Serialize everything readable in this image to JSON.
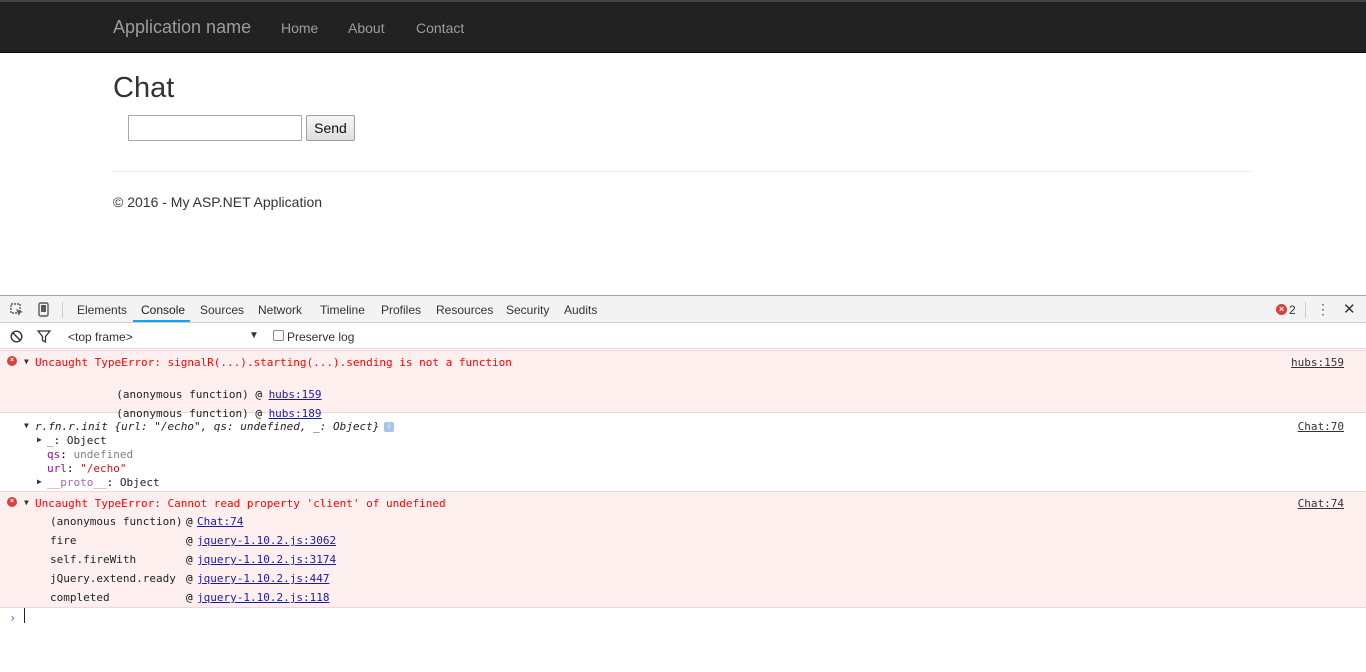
{
  "navbar": {
    "brand": "Application name",
    "links": [
      "Home",
      "About",
      "Contact"
    ]
  },
  "page": {
    "title": "Chat",
    "input_value": "",
    "send_label": "Send",
    "footer": "© 2016 - My ASP.NET Application"
  },
  "devtools": {
    "tabs": [
      "Elements",
      "Console",
      "Sources",
      "Network",
      "Timeline",
      "Profiles",
      "Resources",
      "Security",
      "Audits"
    ],
    "active_tab": "Console",
    "error_count": "2",
    "error_badge_glyph": "×",
    "more_glyph": "⋮",
    "close_glyph": "✕",
    "frame_select": "<top frame>",
    "preserve_log": {
      "label": "Preserve log",
      "checked": false
    },
    "icons": {
      "inspect": "inspect-element-icon",
      "device": "device-mode-icon",
      "clear": "clear-console-icon",
      "filter": "filter-icon"
    },
    "colors": {
      "error_bg": "#fff0f0",
      "error_text": "#ff0000",
      "link": "#1a1aa6",
      "accent": "#03a9f4"
    }
  },
  "console": {
    "messages": [
      {
        "type": "error",
        "text": "Uncaught TypeError: signalR(...).starting(...).sending is not a function",
        "source": "hubs:159",
        "stack": [
          {
            "fn": "(anonymous function)",
            "at": "@",
            "loc": "hubs:159"
          },
          {
            "fn": "(anonymous function)",
            "at": "@",
            "loc": "hubs:189"
          }
        ]
      },
      {
        "type": "log",
        "head": "r.fn.r.init {url: \"/echo\", qs: undefined, _: Object}",
        "info": "i",
        "source": "Chat:70",
        "props": [
          {
            "key": "_",
            "sep": ": ",
            "val": "Object"
          },
          {
            "key": "qs",
            "sep": ": ",
            "val": "undefined"
          },
          {
            "key": "url",
            "sep": ": ",
            "val": "\"/echo\""
          },
          {
            "key": "__proto__",
            "sep": ": ",
            "val": "Object"
          }
        ]
      },
      {
        "type": "error",
        "text": "Uncaught TypeError: Cannot read property 'client' of undefined",
        "source": "Chat:74",
        "stack": [
          {
            "fn": "(anonymous function)",
            "at": "@",
            "loc": "Chat:74"
          },
          {
            "fn": "fire",
            "at": "@",
            "loc": "jquery-1.10.2.js:3062"
          },
          {
            "fn": "self.fireWith",
            "at": "@",
            "loc": "jquery-1.10.2.js:3174"
          },
          {
            "fn": "jQuery.extend.ready",
            "at": "@",
            "loc": "jquery-1.10.2.js:447"
          },
          {
            "fn": "completed",
            "at": "@",
            "loc": "jquery-1.10.2.js:118"
          }
        ]
      }
    ],
    "prompt": "›"
  }
}
